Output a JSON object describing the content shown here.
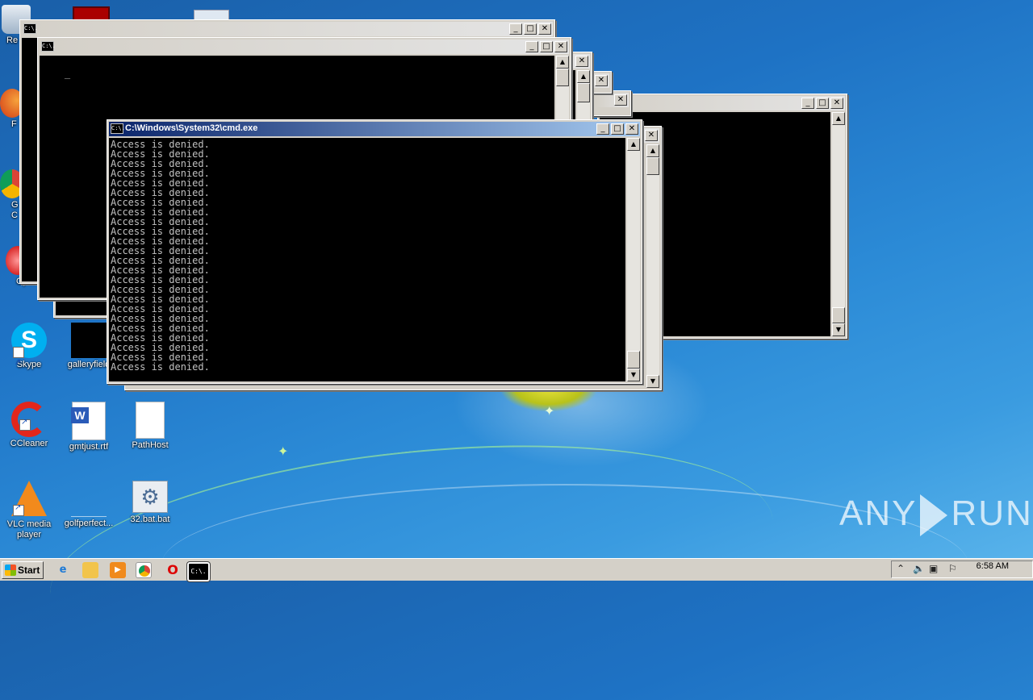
{
  "desktop": {
    "icons": [
      {
        "label": "Re",
        "name": "recycle-bin"
      },
      {
        "label": "F",
        "name": "firefox"
      },
      {
        "label": "G C",
        "name": "chrome"
      },
      {
        "label": "Oper",
        "name": "opera"
      },
      {
        "label": "Skype",
        "name": "skype"
      },
      {
        "label": "galleryfield",
        "name": "galleryfield"
      },
      {
        "label": "CCleaner",
        "name": "ccleaner"
      },
      {
        "label": "gmtjust.rtf",
        "name": "gmtjust-rtf"
      },
      {
        "label": "PathHost",
        "name": "pathhost"
      },
      {
        "label": "VLC media player",
        "name": "vlc"
      },
      {
        "label": "golfperfect...",
        "name": "golfperfect"
      },
      {
        "label": "32.bat.bat",
        "name": "32-bat"
      }
    ]
  },
  "windows": {
    "cmd_icon_text": "C:\\.",
    "active_title": "C:\\Windows\\System32\\cmd.exe",
    "buttons": {
      "minimize": "_",
      "maximize": "□",
      "close": "✕"
    },
    "console_lines": [
      "Access is denied.",
      "Access is denied.",
      "Access is denied.",
      "Access is denied.",
      "Access is denied.",
      "Access is denied.",
      "Access is denied.",
      "Access is denied.",
      "Access is denied.",
      "Access is denied.",
      "Access is denied.",
      "Access is denied.",
      "Access is denied.",
      "Access is denied.",
      "Access is denied.",
      "Access is denied.",
      "Access is denied.",
      "Access is denied.",
      "Access is denied.",
      "Access is denied.",
      "Access is denied.",
      "Access is denied.",
      "Access is denied.",
      "Access is denied."
    ],
    "bg_console_cursor": "_"
  },
  "taskbar": {
    "start_label": "Start",
    "pinned": [
      "ie-icon",
      "explorer-icon",
      "media-player-icon",
      "chrome-icon",
      "opera-icon",
      "cmd-icon"
    ],
    "clock": "6:58 AM"
  },
  "watermark": {
    "left": "ANY",
    "right": "RUN"
  }
}
